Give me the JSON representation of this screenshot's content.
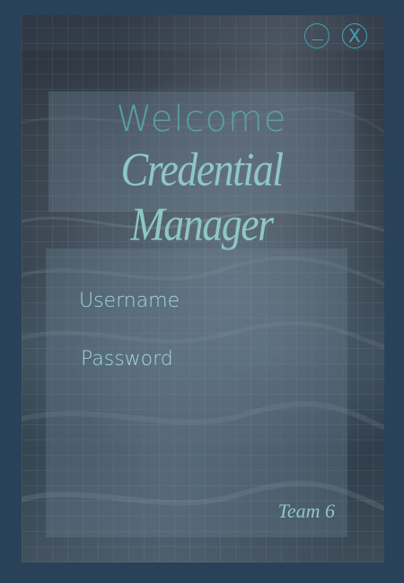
{
  "window": {
    "minimize_icon": "minimize-icon",
    "close_icon": "close-icon",
    "close_glyph": "X"
  },
  "header": {
    "welcome": "Welcome",
    "title": "Credential Manager"
  },
  "form": {
    "username_label": "Username",
    "password_label": "Password",
    "username_value": "",
    "password_value": ""
  },
  "footer": {
    "team": "Team 6"
  },
  "colors": {
    "frame": "#2a4259",
    "accent": "#3fa3b3",
    "title": "#8ec7c4",
    "label": "#9fd8e0"
  }
}
